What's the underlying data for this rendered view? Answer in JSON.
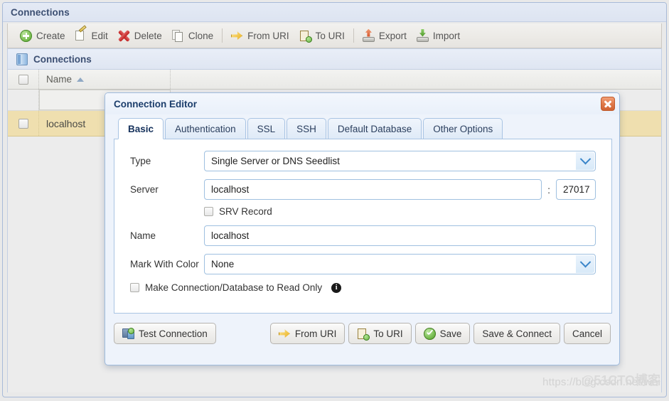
{
  "window": {
    "title": "Connections"
  },
  "toolbar": {
    "items": [
      {
        "label": "Create",
        "icon": "create-plus-icon"
      },
      {
        "label": "Edit",
        "icon": "edit-pencil-icon"
      },
      {
        "label": "Delete",
        "icon": "delete-x-icon"
      },
      {
        "label": "Clone",
        "icon": "clone-pages-icon"
      },
      {
        "label": "From URI",
        "icon": "from-uri-arrow-icon"
      },
      {
        "label": "To URI",
        "icon": "to-uri-clipboard-icon"
      },
      {
        "label": "Export",
        "icon": "export-up-arrow-icon"
      },
      {
        "label": "Import",
        "icon": "import-down-arrow-icon"
      }
    ]
  },
  "grid": {
    "panel_title": "Connections",
    "columns": [
      "Name"
    ],
    "sort": {
      "column": "Name",
      "direction": "asc"
    },
    "rows": [
      {
        "name": "",
        "selected": false,
        "highlighted": false
      },
      {
        "name": "localhost",
        "selected": false,
        "highlighted": true
      }
    ]
  },
  "dialog": {
    "title": "Connection Editor",
    "close_label": "×",
    "tabs": [
      {
        "label": "Basic",
        "active": true
      },
      {
        "label": "Authentication",
        "active": false
      },
      {
        "label": "SSL",
        "active": false
      },
      {
        "label": "SSH",
        "active": false
      },
      {
        "label": "Default Database",
        "active": false
      },
      {
        "label": "Other Options",
        "active": false
      }
    ],
    "form": {
      "type_label": "Type",
      "type_value": "Single Server or DNS Seedlist",
      "server_label": "Server",
      "server_value": "localhost",
      "port_separator": ":",
      "port_value": "27017",
      "srv_label": "SRV Record",
      "srv_checked": false,
      "name_label": "Name",
      "name_value": "localhost",
      "mark_color_label": "Mark With Color",
      "mark_color_value": "None",
      "readonly_label": "Make Connection/Database to Read Only",
      "readonly_checked": false,
      "readonly_info": "i"
    },
    "footer": {
      "test_connection": "Test Connection",
      "from_uri": "From URI",
      "to_uri": "To URI",
      "save": "Save",
      "save_and_connect": "Save & Connect",
      "cancel": "Cancel"
    }
  },
  "watermark": {
    "url": "https://blog.csdn.net/wei",
    "overlay": "@51CTO博客"
  },
  "colors": {
    "accent_blue": "#3c4f72",
    "dialog_border": "#9fbbdd",
    "row_highlight": "#efdfaf",
    "close_button": "#e07a4a",
    "field_border": "#9fc0e0"
  }
}
